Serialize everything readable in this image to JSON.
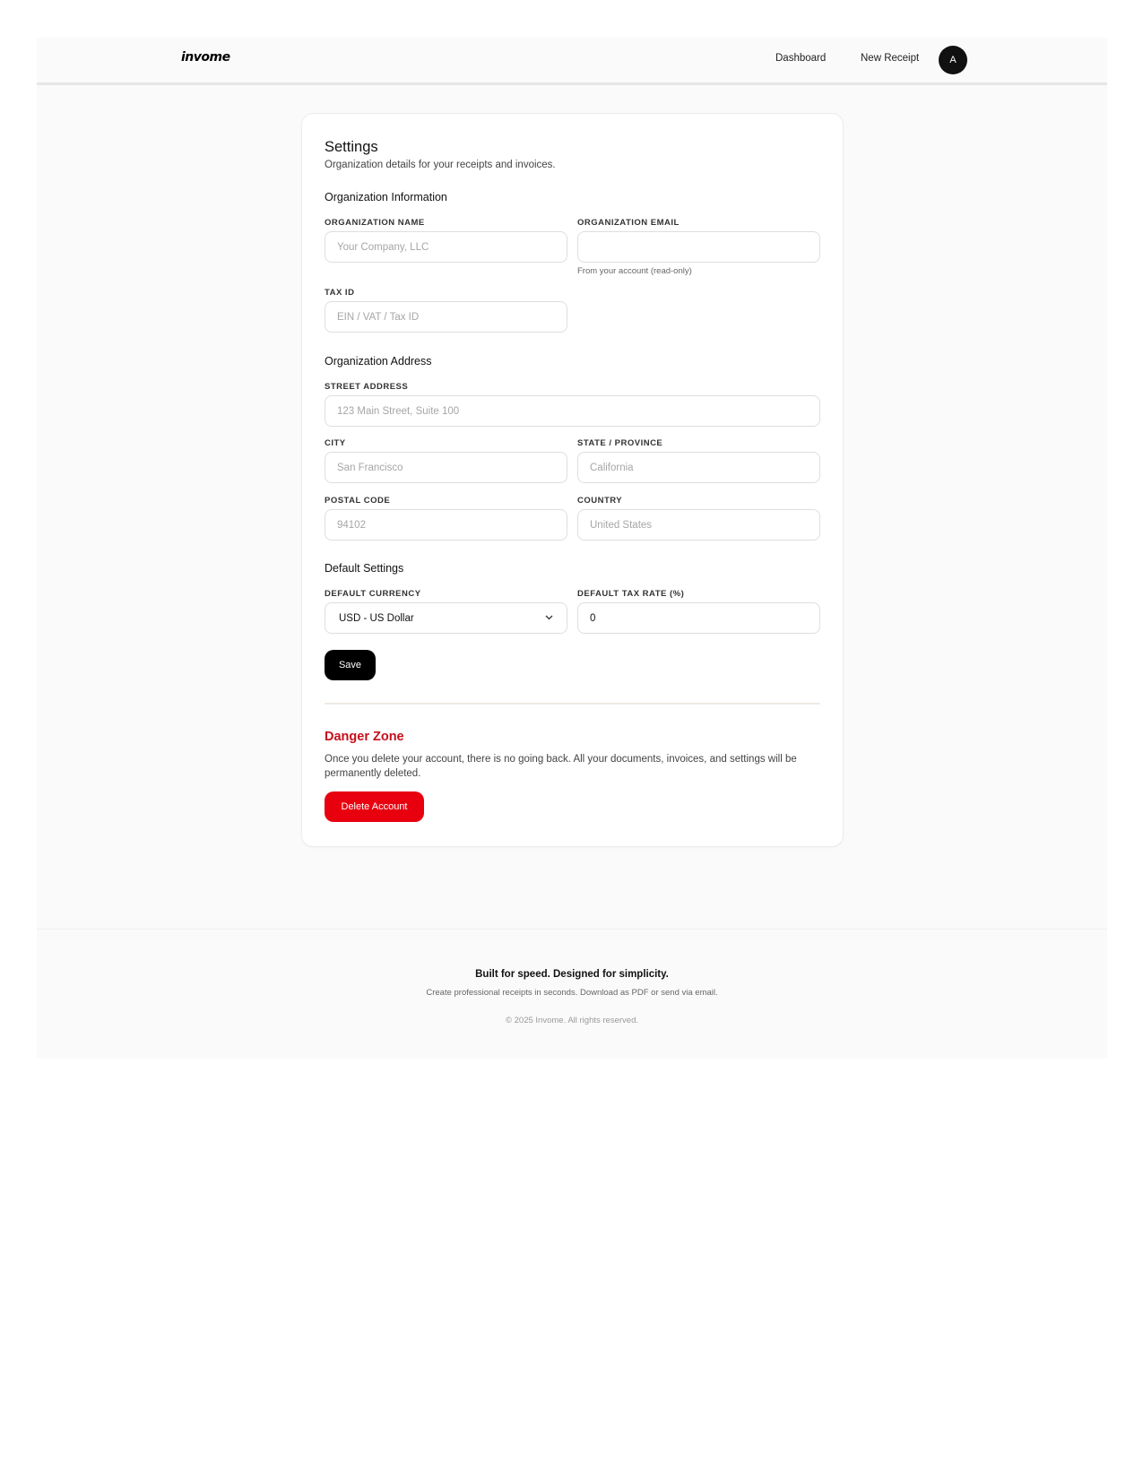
{
  "nav": {
    "logo": "invome",
    "dashboard": "Dashboard",
    "new_receipt": "New Receipt",
    "avatar_initial": "A"
  },
  "settings": {
    "title": "Settings",
    "subtitle": "Organization details for your receipts and invoices."
  },
  "org_info": {
    "heading": "Organization Information",
    "name_label": "ORGANIZATION NAME",
    "name_placeholder": "Your Company, LLC",
    "name_value": "",
    "email_label": "ORGANIZATION EMAIL",
    "email_value": "",
    "email_hint": "From your account (read-only)",
    "tax_id_label": "TAX ID",
    "tax_id_placeholder": "EIN / VAT / Tax ID",
    "tax_id_value": ""
  },
  "address": {
    "heading": "Organization Address",
    "street_label": "STREET ADDRESS",
    "street_placeholder": "123 Main Street, Suite 100",
    "city_label": "CITY",
    "city_placeholder": "San Francisco",
    "state_label": "STATE / PROVINCE",
    "state_placeholder": "California",
    "postal_label": "POSTAL CODE",
    "postal_placeholder": "94102",
    "country_label": "COUNTRY",
    "country_placeholder": "United States"
  },
  "defaults": {
    "heading": "Default Settings",
    "currency_label": "DEFAULT CURRENCY",
    "currency_value": "USD - US Dollar",
    "tax_rate_label": "DEFAULT TAX RATE (%)",
    "tax_rate_value": "0"
  },
  "save_label": "Save",
  "danger": {
    "title": "Danger Zone",
    "text": "Once you delete your account, there is no going back. All your documents, invoices, and settings will be permanently deleted.",
    "delete_label": "Delete Account"
  },
  "footer": {
    "tagline": "Built for speed. Designed for simplicity.",
    "sub": "Create professional receipts in seconds. Download as PDF or send via email.",
    "copyright": "© 2025 Invome. All rights reserved."
  },
  "colors": {
    "accent": "#000000",
    "danger": "#e8000f",
    "danger_text": "#c4101e",
    "page_bg": "#fafafa"
  }
}
